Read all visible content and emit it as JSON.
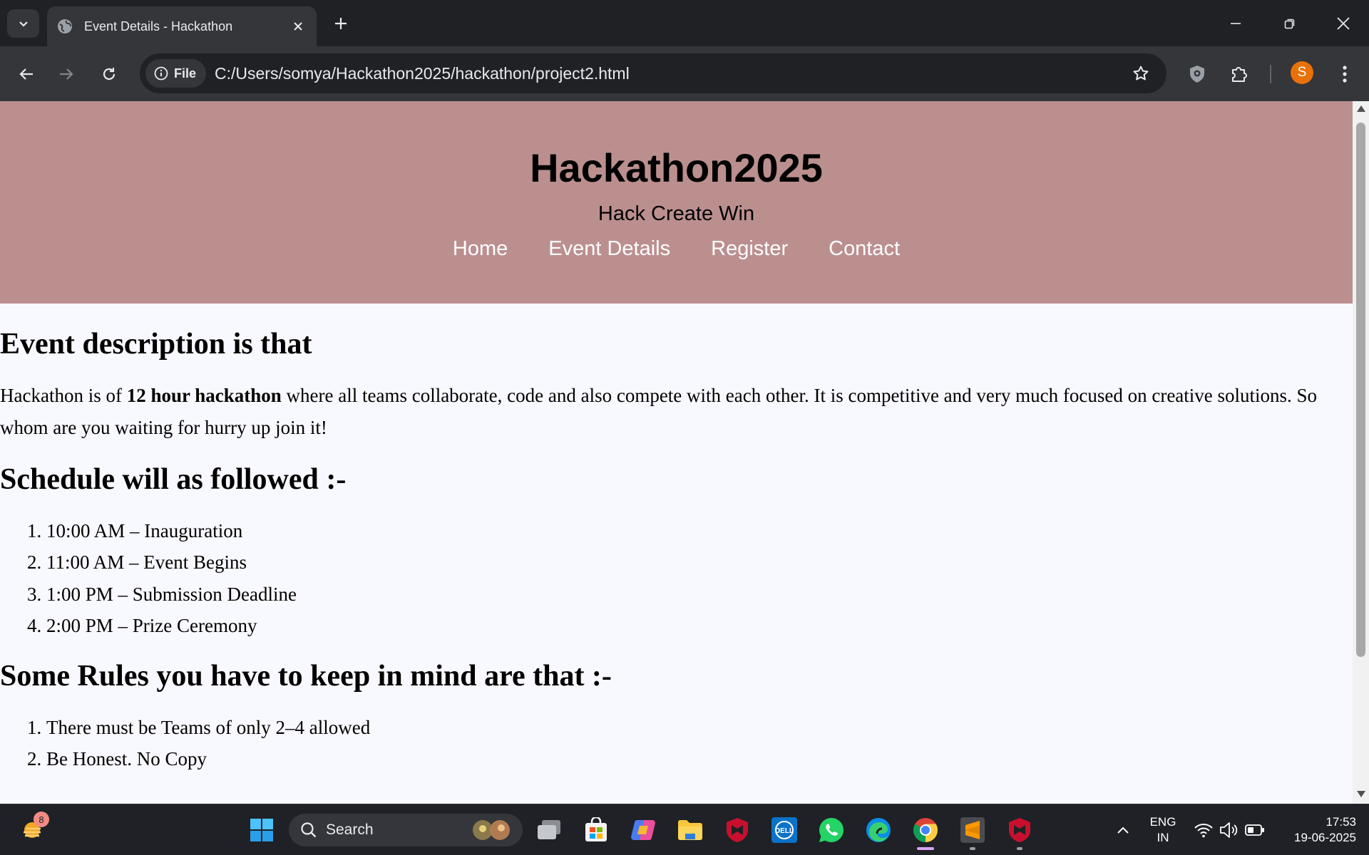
{
  "browser": {
    "tab_title": "Event Details - Hackathon",
    "url": "C:/Users/somya/Hackathon2025/hackathon/project2.html",
    "scheme_chip": "File",
    "profile_initial": "S"
  },
  "site": {
    "title": "Hackathon2025",
    "tagline": "Hack Create Win",
    "nav": [
      "Home",
      "Event Details",
      "Register",
      "Contact"
    ]
  },
  "content": {
    "description_heading": "Event description is that",
    "description_before": "Hackathon is of ",
    "description_bold": "12 hour hackathon",
    "description_after": " where all teams collaborate, code and also compete with each other. It is competitive and very much focused on creative solutions. So whom are you waiting for hurry up join it!",
    "schedule_heading": "Schedule will as followed :-",
    "schedule": [
      "10:00 AM – Inauguration",
      "11:00 AM – Event Begins",
      "1:00 PM – Submission Deadline",
      "2:00 PM – Prize Ceremony"
    ],
    "rules_heading": "Some Rules you have to keep in mind are that :-",
    "rules": [
      "There must be Teams of only 2–4 allowed",
      "Be Honest. No Copy"
    ]
  },
  "taskbar": {
    "search_label": "Search",
    "widget_badge": "8",
    "lang_line1": "ENG",
    "lang_line2": "IN",
    "time": "17:53",
    "date": "19-06-2025"
  },
  "colors": {
    "header_bg": "#bc8f8f",
    "page_bg": "#f8f8ff",
    "nav_link": "#ffffff"
  }
}
